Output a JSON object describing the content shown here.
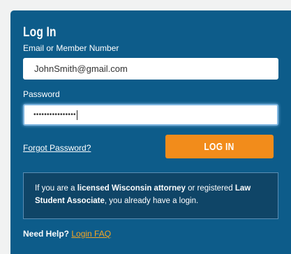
{
  "form": {
    "title": "Log In",
    "email_label": "Email or Member Number",
    "email_value": "JohnSmith@gmail.com",
    "password_label": "Password",
    "password_masked": "••••••••••••••••",
    "forgot_link": "Forgot Password?",
    "login_button": "LOG IN"
  },
  "info": {
    "prefix": "If you are a ",
    "bold1": "licensed Wisconsin attorney",
    "mid": " or registered ",
    "bold2": "Law Student Associate",
    "suffix": ", you already have a login."
  },
  "help": {
    "label": "Need Help?",
    "link": "Login FAQ"
  },
  "colors": {
    "panel": "#0d5c8a",
    "button": "#f28c1b",
    "infobox": "#0f4567",
    "link_accent": "#f5a623"
  }
}
